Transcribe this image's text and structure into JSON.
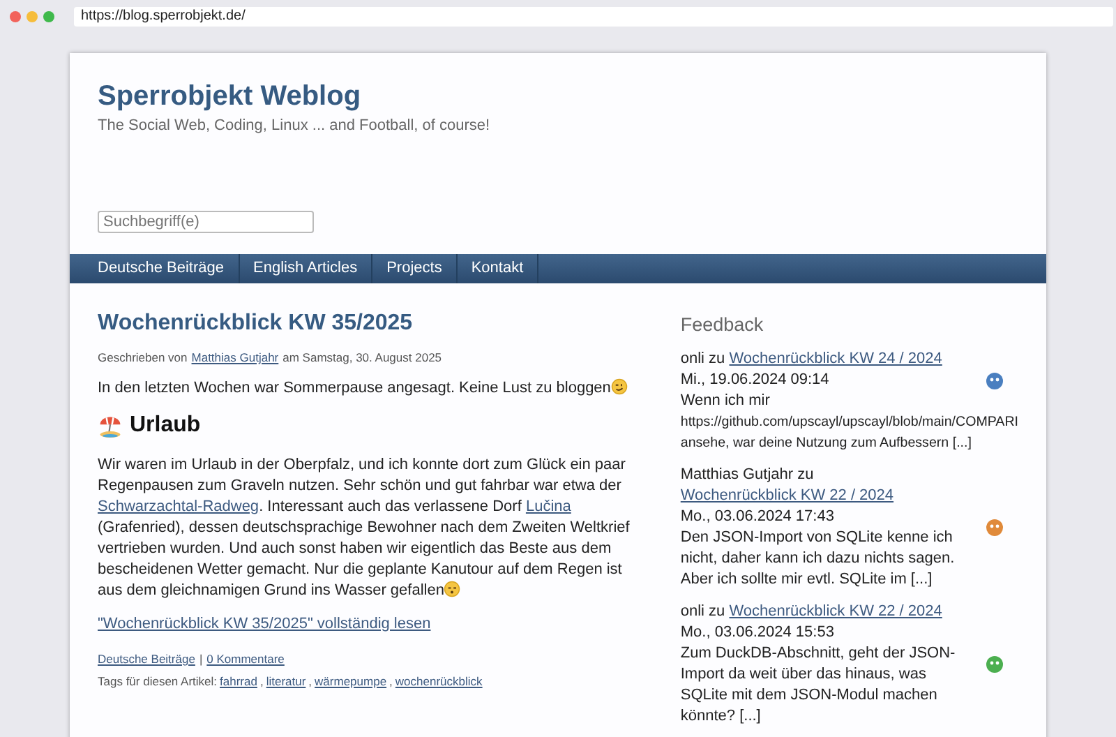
{
  "browser": {
    "url": "https://blog.sperrobjekt.de/"
  },
  "site": {
    "title": "Sperrobjekt Weblog",
    "tagline": "The Social Web, Coding, Linux ... and Football, of course!"
  },
  "search": {
    "placeholder": "Suchbegriff(e)"
  },
  "nav": [
    "Deutsche Beiträge",
    "English Articles",
    "Projects",
    "Kontakt"
  ],
  "post": {
    "title": "Wochenrückblick KW 35/2025",
    "meta_prefix": "Geschrieben von",
    "author": "Matthias Gutjahr",
    "meta_suffix": "am Samstag, 30. August 2025",
    "intro": "In den letzten Wochen war Sommerpause angesagt. Keine Lust zu bloggen",
    "heading": "Urlaub",
    "paragraph": [
      {
        "kind": "text",
        "text": "Wir waren im Urlaub in der Oberpfalz, und ich konnte dort zum Glück ein paar Regenpausen zum Graveln nutzen. Sehr schön und gut fahrbar war etwa der "
      },
      {
        "kind": "link",
        "text": "Schwarzachtal-Radweg"
      },
      {
        "kind": "text",
        "text": ". Interessant auch das verlassene Dorf "
      },
      {
        "kind": "link",
        "text": "Lučina"
      },
      {
        "kind": "text",
        "text": " (Grafenried), dessen deutschsprachige Bewohner nach dem Zweiten Weltkrief vertrieben wurden. Und auch sonst haben wir eigentlich das Beste aus dem bescheidenen Wetter gemacht. Nur die geplante Kanutour auf dem Regen ist aus dem gleichnamigen Grund ins Wasser gefallen"
      }
    ],
    "read_more": "\"Wochenrückblick KW 35/2025\" vollständig lesen",
    "category": "Deutsche Beiträge",
    "separator": "|",
    "comments": "0 Kommentare",
    "tags_label": "Tags für diesen Artikel:",
    "tag_separator": ",",
    "tags": [
      "fahrrad",
      "literatur",
      "wärmepumpe",
      "wochenrückblick"
    ]
  },
  "feedback": {
    "title": "Feedback",
    "items": [
      {
        "author": "onli",
        "zu": "zu",
        "link": "Wochenrückblick KW 24 / 2024",
        "date": "Mi., 19.06.2024 09:14",
        "text": "Wenn ich mir",
        "extra": [
          "https://github.com/upscayl/upscayl/blob/main/COMPARI",
          "ansehe, war deine Nutzung zum Aufbessern [...]"
        ],
        "color": "#4a7fc0"
      },
      {
        "author": "Matthias Gutjahr",
        "zu": "zu",
        "link": "Wochenrückblick KW 22 / 2024",
        "date": "Mo., 03.06.2024 17:43",
        "text": "Den JSON-Import von SQLite kenne ich nicht, daher kann ich dazu nichts sagen. Aber ich sollte mir evtl. SQLite im [...]",
        "color": "#e08a3a"
      },
      {
        "author": "onli",
        "zu": "zu",
        "link": "Wochenrückblick KW 22 / 2024",
        "date": "Mo., 03.06.2024 15:53",
        "text": "Zum DuckDB-Abschnitt, geht der JSON-Import da weit über das hinaus, was SQLite mit dem JSON-Modul machen könnte? [...]",
        "color": "#4caf50"
      }
    ]
  }
}
